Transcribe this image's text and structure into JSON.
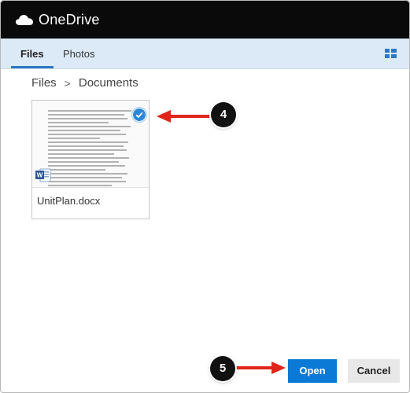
{
  "header": {
    "app_name": "OneDrive",
    "icon": "cloud-icon"
  },
  "tabs": [
    {
      "label": "Files",
      "active": true
    },
    {
      "label": "Photos",
      "active": false
    }
  ],
  "view_toggle_icon": "grid-view-icon",
  "breadcrumb": {
    "root": "Files",
    "separator": ">",
    "current": "Documents"
  },
  "file": {
    "name": "UnitPlan.docx",
    "selected": true,
    "type_icon": "word-document-icon"
  },
  "annotations": [
    {
      "number": "4"
    },
    {
      "number": "5"
    }
  ],
  "buttons": {
    "open": "Open",
    "cancel": "Cancel"
  },
  "colors": {
    "accent": "#0a7ad6",
    "annotation_arrow": "#e0261b",
    "topbar": "#0a0a0a",
    "tabbar": "#dceaf7"
  }
}
